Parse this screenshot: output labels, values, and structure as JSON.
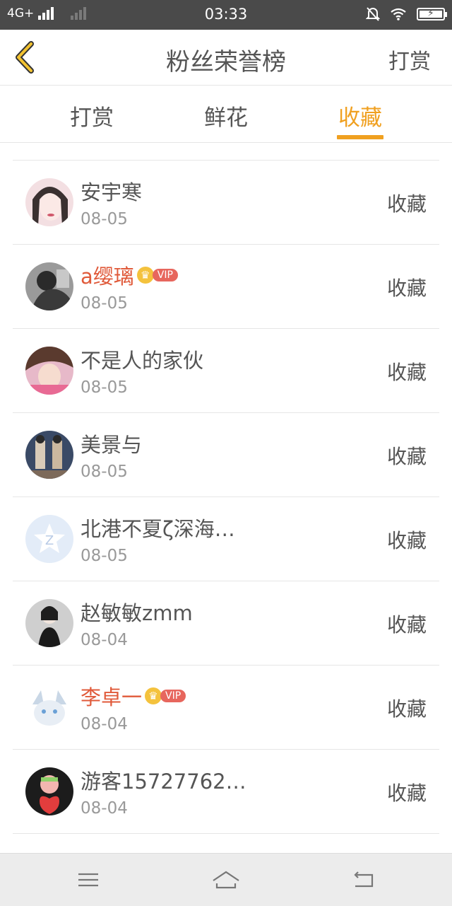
{
  "status": {
    "network": "4G+",
    "time": "03:33"
  },
  "header": {
    "title": "粉丝荣誉榜",
    "action_label": "打赏"
  },
  "tabs": [
    {
      "label": "打赏",
      "active": false
    },
    {
      "label": "鲜花",
      "active": false
    },
    {
      "label": "收藏",
      "active": true
    }
  ],
  "accent_color": "#f0a020",
  "vip_badge_text": "VIP",
  "list": [
    {
      "name": "安宇寒",
      "date": "08-05",
      "action": "收藏",
      "vip": false
    },
    {
      "name": "a缨璃",
      "date": "08-05",
      "action": "收藏",
      "vip": true
    },
    {
      "name": "不是人的家伙",
      "date": "08-05",
      "action": "收藏",
      "vip": false
    },
    {
      "name": "美景与",
      "date": "08-05",
      "action": "收藏",
      "vip": false
    },
    {
      "name": "北港不夏ζ深海…",
      "date": "08-05",
      "action": "收藏",
      "vip": false
    },
    {
      "name": "赵敏敏zmm",
      "date": "08-04",
      "action": "收藏",
      "vip": false
    },
    {
      "name": "李卓一",
      "date": "08-04",
      "action": "收藏",
      "vip": true
    },
    {
      "name": "游客15727762…",
      "date": "08-04",
      "action": "收藏",
      "vip": false
    }
  ]
}
